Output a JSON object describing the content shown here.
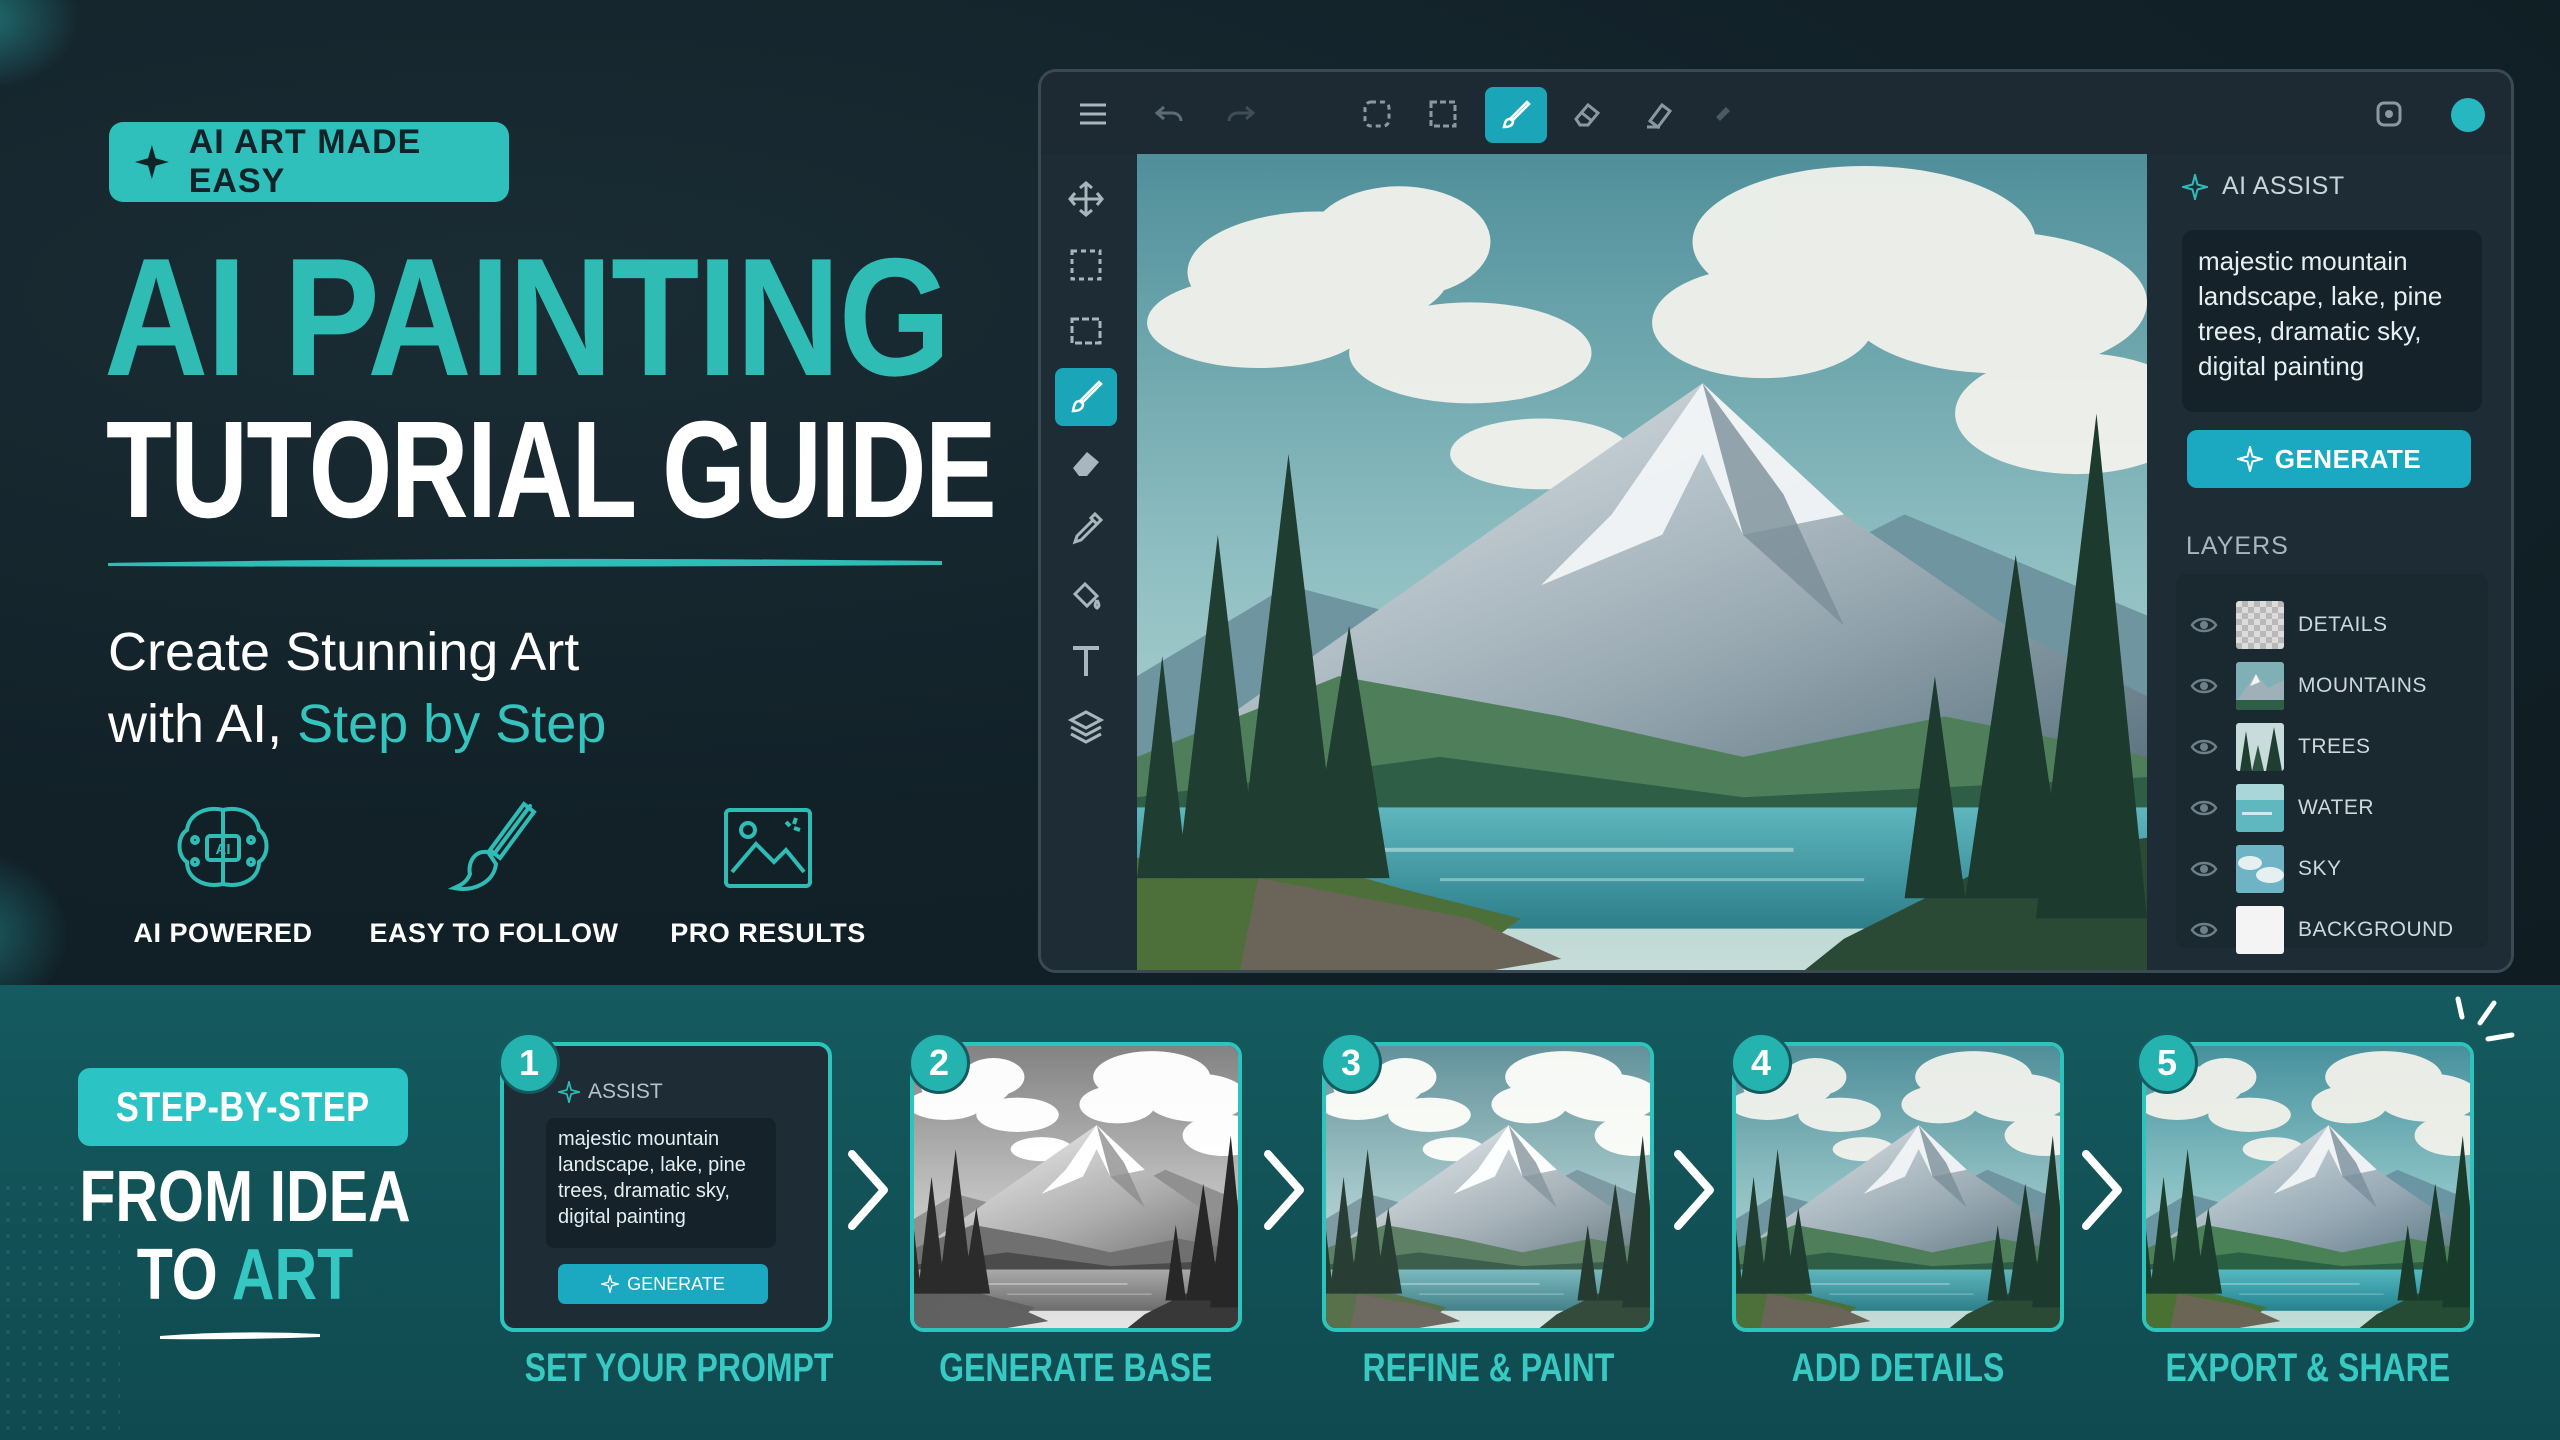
{
  "hero": {
    "badge": "AI ART MADE EASY",
    "title_line1": "AI PAINTING",
    "title_line2": "TUTORIAL GUIDE",
    "subtitle_line1": "Create Stunning Art",
    "subtitle_line2_prefix": "with AI, ",
    "subtitle_line2_accent": "Step by Step",
    "features": [
      {
        "label": "AI POWERED",
        "icon": "brain-ai-icon"
      },
      {
        "label": "EASY TO FOLLOW",
        "icon": "paintbrush-icon"
      },
      {
        "label": "PRO RESULTS",
        "icon": "image-frame-icon"
      }
    ]
  },
  "app": {
    "toolbar_icons": [
      "menu-icon",
      "undo-icon",
      "redo-icon",
      "lasso-select-icon",
      "rect-select-icon",
      "brush-icon",
      "eraser-icon",
      "smudge-icon",
      "fill-icon",
      "settings-icon"
    ],
    "left_tools": [
      "move-icon",
      "marquee-icon",
      "rect-marquee-icon",
      "brush-icon",
      "eraser-icon",
      "eyedropper-icon",
      "fill-bucket-icon",
      "text-icon",
      "layers-icon"
    ],
    "ai_assist": {
      "heading": "AI ASSIST",
      "prompt": "majestic mountain landscape, lake, pine trees, dramatic sky, digital painting",
      "generate_label": "GENERATE"
    },
    "layers": {
      "heading": "LAYERS",
      "items": [
        {
          "name": "DETAILS"
        },
        {
          "name": "MOUNTAINS"
        },
        {
          "name": "TREES"
        },
        {
          "name": "WATER"
        },
        {
          "name": "SKY"
        },
        {
          "name": "BACKGROUND"
        }
      ]
    },
    "colors": {
      "accent": "#1ba9c2",
      "teal": "#2fc0bb"
    }
  },
  "strip": {
    "pill": "STEP-BY-STEP",
    "headline_line1": "FROM IDEA",
    "headline_line2_prefix": "TO ",
    "headline_line2_accent": "ART",
    "steps": [
      {
        "num": "1",
        "label": "SET YOUR PROMPT"
      },
      {
        "num": "2",
        "label": "GENERATE BASE"
      },
      {
        "num": "3",
        "label": "REFINE & PAINT"
      },
      {
        "num": "4",
        "label": "ADD DETAILS"
      },
      {
        "num": "5",
        "label": "EXPORT & SHARE"
      }
    ],
    "mini_assist": {
      "heading": "ASSIST",
      "prompt": "majestic mountain landscape, lake, pine trees, dramatic sky, digital painting",
      "generate_label": "GENERATE"
    }
  }
}
